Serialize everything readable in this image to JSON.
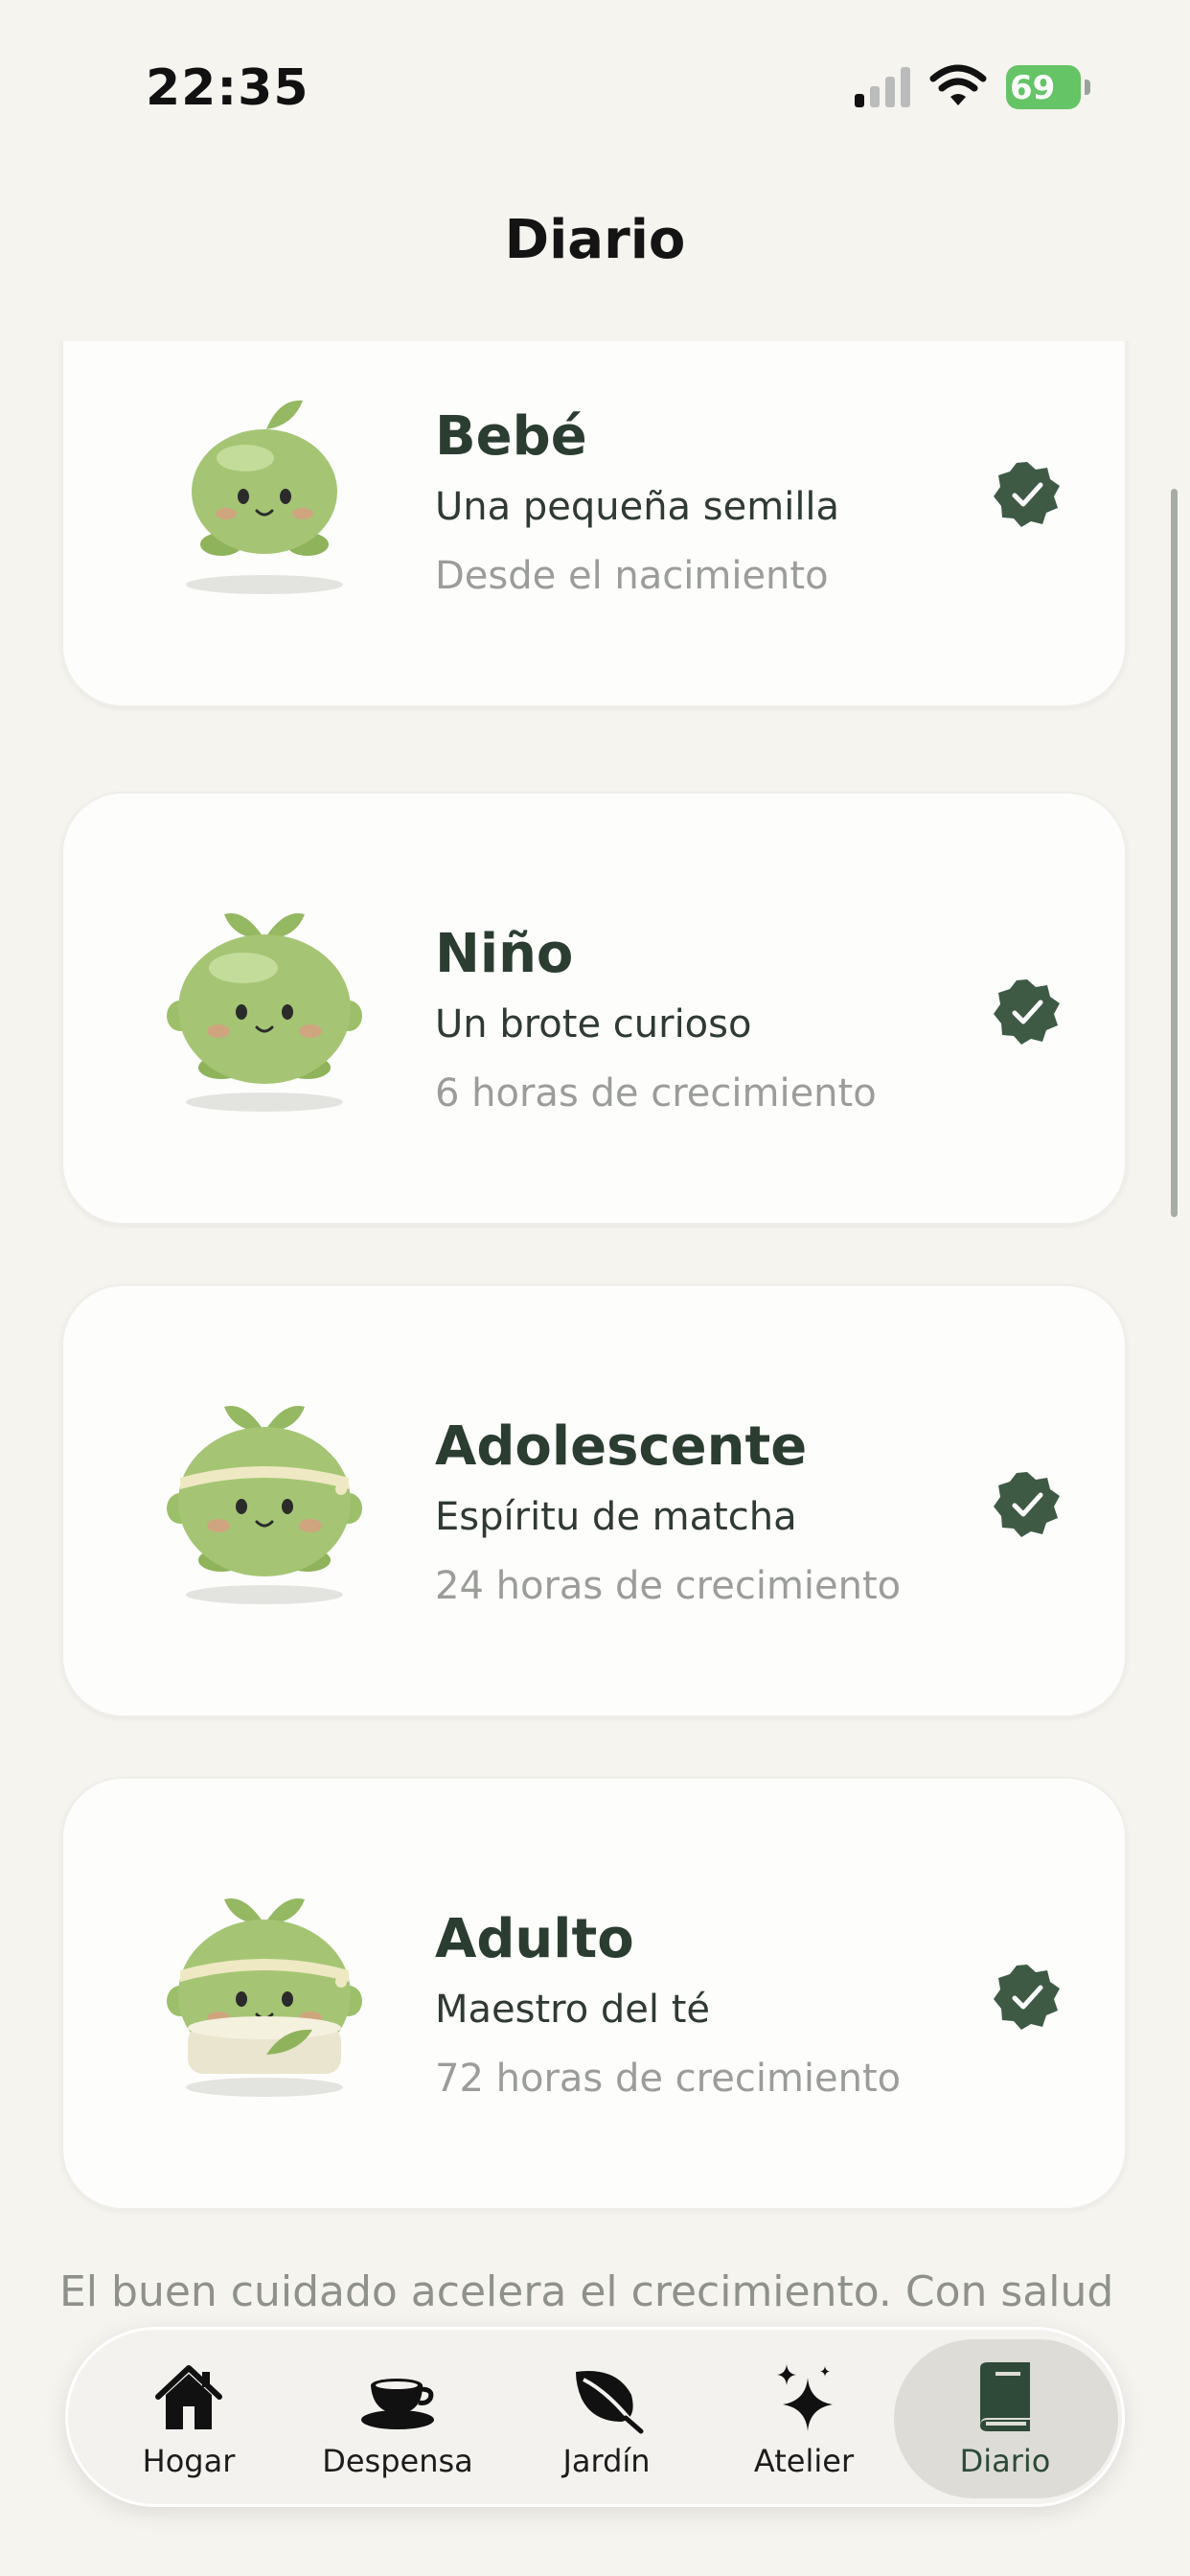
{
  "status_bar": {
    "time": "22:35",
    "battery": "69"
  },
  "header": {
    "title": "Diario"
  },
  "stages": [
    {
      "name": "Bebé",
      "subtitle": "Una pequeña semilla",
      "duration": "Desde el nacimiento",
      "completed": true
    },
    {
      "name": "Niño",
      "subtitle": "Un brote curioso",
      "duration": "6 horas de crecimiento",
      "completed": true
    },
    {
      "name": "Adolescente",
      "subtitle": "Espíritu de matcha",
      "duration": "24 horas de crecimiento",
      "completed": true
    },
    {
      "name": "Adulto",
      "subtitle": "Maestro del té",
      "duration": "72 horas de crecimiento",
      "completed": true
    }
  ],
  "footer_note": "El buen cuidado acelera el crecimiento. Con salud",
  "tabs": [
    {
      "label": "Hogar",
      "icon": "house-icon"
    },
    {
      "label": "Despensa",
      "icon": "teacup-icon"
    },
    {
      "label": "Jardín",
      "icon": "leaf-icon"
    },
    {
      "label": "Atelier",
      "icon": "sparkles-icon"
    },
    {
      "label": "Diario",
      "icon": "book-icon",
      "active": true
    }
  ],
  "colors": {
    "accent": "#3e5a45",
    "background": "#f6f4ef",
    "creature_green": "#9dc06a",
    "battery": "#65c466"
  }
}
